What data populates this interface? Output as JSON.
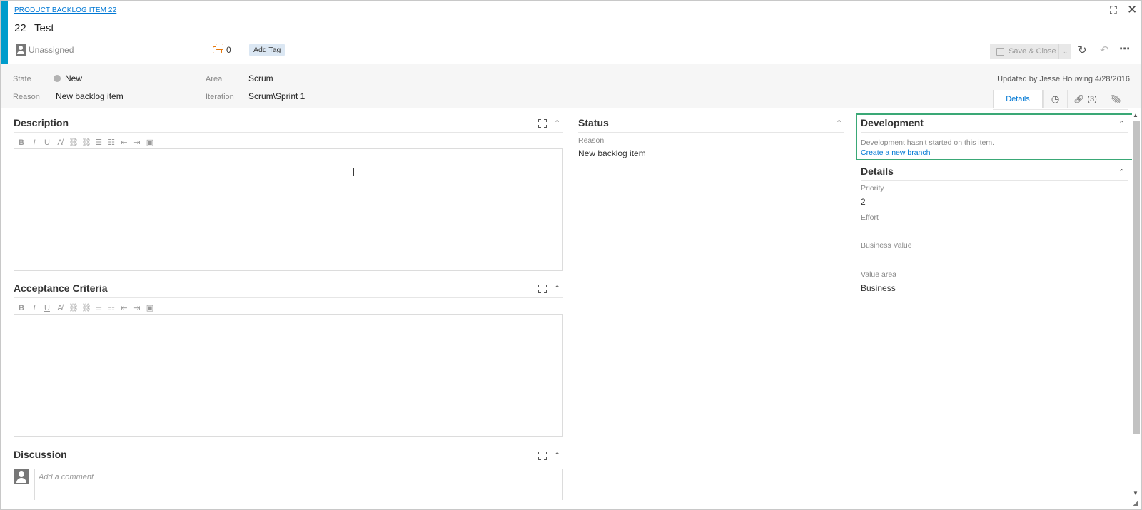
{
  "header": {
    "type_link": "PRODUCT BACKLOG ITEM 22",
    "id": "22",
    "title": "Test",
    "assigned": "Unassigned",
    "comment_count": "0",
    "add_tag": "Add Tag",
    "save_close": "Save & Close",
    "icons": [
      "fullscreen-icon",
      "close-icon",
      "save-icon",
      "refresh-icon",
      "undo-icon",
      "more-icon"
    ]
  },
  "fields": {
    "state_label": "State",
    "state_value": "New",
    "reason_label": "Reason",
    "reason_value": "New backlog item",
    "area_label": "Area",
    "area_value": "Scrum",
    "iteration_label": "Iteration",
    "iteration_value": "Scrum\\Sprint 1",
    "updated": "Updated by Jesse Houwing 4/28/2016",
    "state_color": "#b2b2b2"
  },
  "tabs": {
    "details": "Details",
    "links": "(3)",
    "icons": [
      "history-icon",
      "link-icon",
      "attachment-icon"
    ]
  },
  "description": {
    "title": "Description"
  },
  "acceptance": {
    "title": "Acceptance Criteria"
  },
  "discussion": {
    "title": "Discussion",
    "placeholder": "Add a comment"
  },
  "status": {
    "title": "Status",
    "reason_label": "Reason",
    "reason_value": "New backlog item"
  },
  "development": {
    "title": "Development",
    "message": "Development hasn't started on this item.",
    "link": "Create a new branch",
    "highlight_color": "#3aa876"
  },
  "details": {
    "title": "Details",
    "priority_label": "Priority",
    "priority_value": "2",
    "effort_label": "Effort",
    "business_value_label": "Business Value",
    "value_area_label": "Value area",
    "value_area_value": "Business"
  },
  "toolbar": {
    "bold": "B",
    "italic": "I",
    "underline": "U",
    "icons": [
      "highlight-icon",
      "link-icon",
      "unlink-icon",
      "bullet-list-icon",
      "numbered-list-icon",
      "outdent-icon",
      "indent-icon",
      "image-icon"
    ]
  },
  "colors": {
    "accent": "#009ccc",
    "link": "#0078d4"
  }
}
